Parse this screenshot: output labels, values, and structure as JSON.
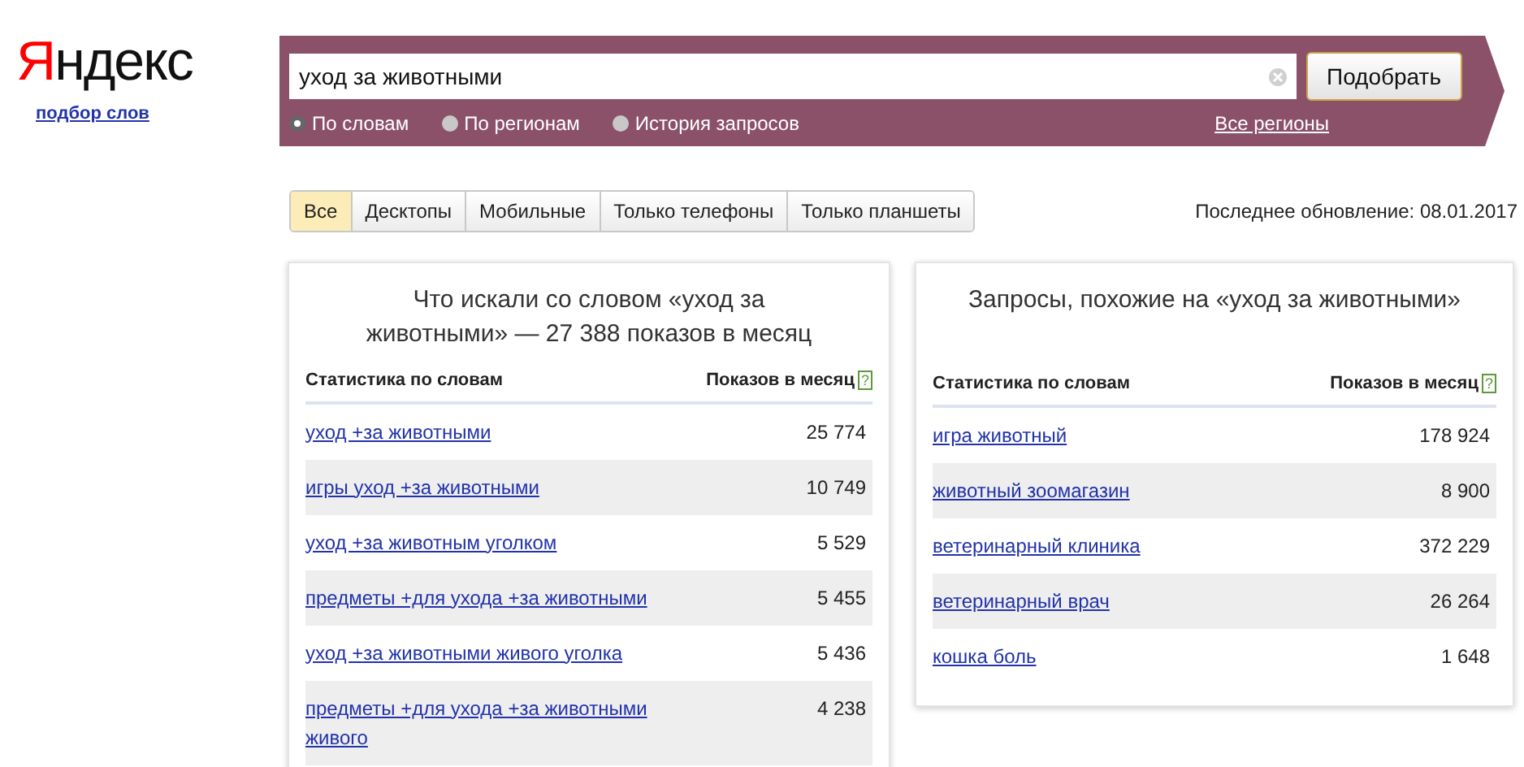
{
  "logo": {
    "parts": [
      "Я",
      "ндекс"
    ]
  },
  "subtitle_link": "подбор слов",
  "search": {
    "value": "уход за животными",
    "button": "Подобрать",
    "modes": [
      {
        "label": "По словам",
        "selected": true
      },
      {
        "label": "По регионам",
        "selected": false
      },
      {
        "label": "История запросов",
        "selected": false
      }
    ],
    "region_link": "Все регионы"
  },
  "tabs": [
    {
      "label": "Все",
      "selected": true
    },
    {
      "label": "Десктопы",
      "selected": false
    },
    {
      "label": "Мобильные",
      "selected": false
    },
    {
      "label": "Только телефоны",
      "selected": false
    },
    {
      "label": "Только планшеты",
      "selected": false
    }
  ],
  "last_update": "Последнее обновление: 08.01.2017",
  "panels": [
    {
      "title": "Что искали со словом «уход за животными» — 27 388 показов в месяц",
      "columns": [
        "Статистика по словам",
        "Показов в месяц"
      ],
      "help": "?",
      "rows": [
        {
          "phrase": "уход +за животными",
          "count": "25 774"
        },
        {
          "phrase": "игры уход +за животными",
          "count": "10 749"
        },
        {
          "phrase": "уход +за животным уголком",
          "count": "5 529"
        },
        {
          "phrase": "предметы +для ухода +за животными",
          "count": "5 455"
        },
        {
          "phrase": "уход +за животными живого уголка",
          "count": "5 436"
        },
        {
          "phrase": "предметы +для ухода +за животными живого",
          "count": "4 238"
        }
      ]
    },
    {
      "title": "Запросы, похожие на «уход за животными»",
      "columns": [
        "Статистика по словам",
        "Показов в месяц"
      ],
      "help": "?",
      "rows": [
        {
          "phrase": "игра животный",
          "count": "178 924"
        },
        {
          "phrase": "животный зоомагазин",
          "count": "8 900"
        },
        {
          "phrase": "ветеринарный клиника",
          "count": "372 229"
        },
        {
          "phrase": "ветеринарный врач",
          "count": "26 264"
        },
        {
          "phrase": "кошка боль",
          "count": "1 648"
        }
      ]
    }
  ]
}
